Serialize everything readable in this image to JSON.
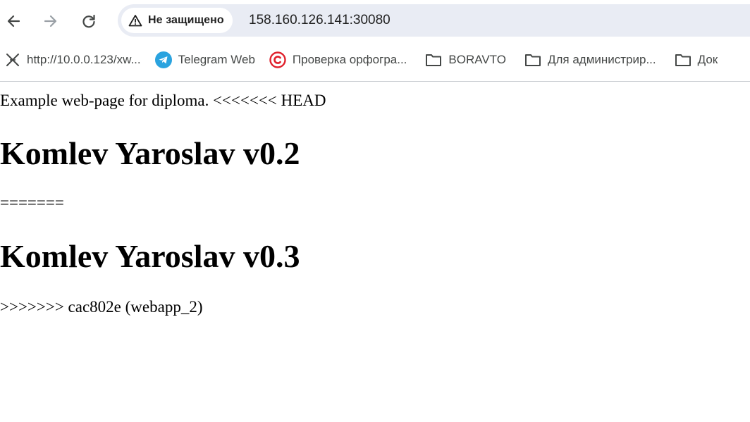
{
  "browser": {
    "security_label": "Не защищено",
    "url": "158.160.126.141:30080",
    "icons": {
      "back": "back-arrow-icon",
      "forward": "forward-arrow-icon",
      "reload": "reload-icon",
      "security": "warning-triangle-icon"
    }
  },
  "bookmarks": [
    {
      "label": "http://10.0.0.123/xw...",
      "icon": "cross-tools-icon"
    },
    {
      "label": "Telegram Web",
      "icon": "telegram-icon"
    },
    {
      "label": "Проверка орфогра...",
      "icon": "copyright-icon"
    },
    {
      "label": "BORAVTO",
      "icon": "folder-icon"
    },
    {
      "label": "Для администрир...",
      "icon": "folder-icon"
    },
    {
      "label": "Док",
      "icon": "folder-icon"
    }
  ],
  "page": {
    "line1": "Example web-page for diploma. <<<<<<< HEAD",
    "heading1": "Komlev Yaroslav v0.2",
    "separator": "=======",
    "heading2": "Komlev Yaroslav v0.3",
    "line2": ">>>>>>> cac802e (webapp_2)"
  },
  "colors": {
    "omnibox_bg": "#e9ecf4",
    "telegram": "#2aa3df",
    "copyright_red": "#e0212c",
    "icon_gray": "#444746"
  }
}
